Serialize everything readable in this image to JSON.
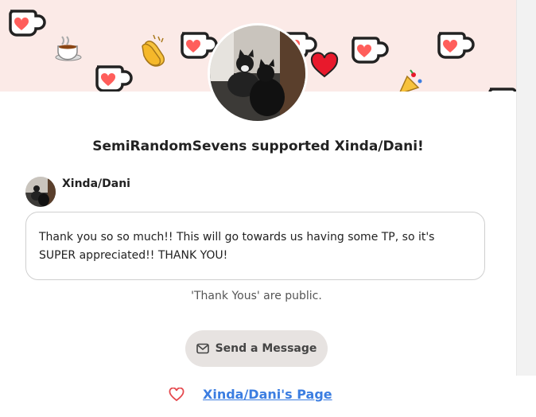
{
  "header": {
    "title": "SemiRandomSevens supported Xinda/Dani!"
  },
  "supporter": {
    "name": "Xinda/Dani"
  },
  "message": {
    "text": "Thank you so so much!! This will go towards us having some TP, so it's SUPER appreciated!! THANK YOU!"
  },
  "note": {
    "text": "'Thank Yous' are public."
  },
  "actions": {
    "send_message_label": "Send a Message",
    "page_link_label": "Xinda/Dani's Page"
  },
  "icons": {
    "banner": [
      "kofi-cup-icon",
      "coffee-cup-icon",
      "clapping-hands-icon",
      "heart-icon",
      "party-popper-icon"
    ],
    "send": "mail-icon",
    "link": "heart-outline-icon"
  },
  "colors": {
    "banner_bg": "#fbeae7",
    "kofi_red": "#ff5e5b",
    "link_blue": "#3b7de1",
    "button_bg": "#e7e3e1"
  }
}
